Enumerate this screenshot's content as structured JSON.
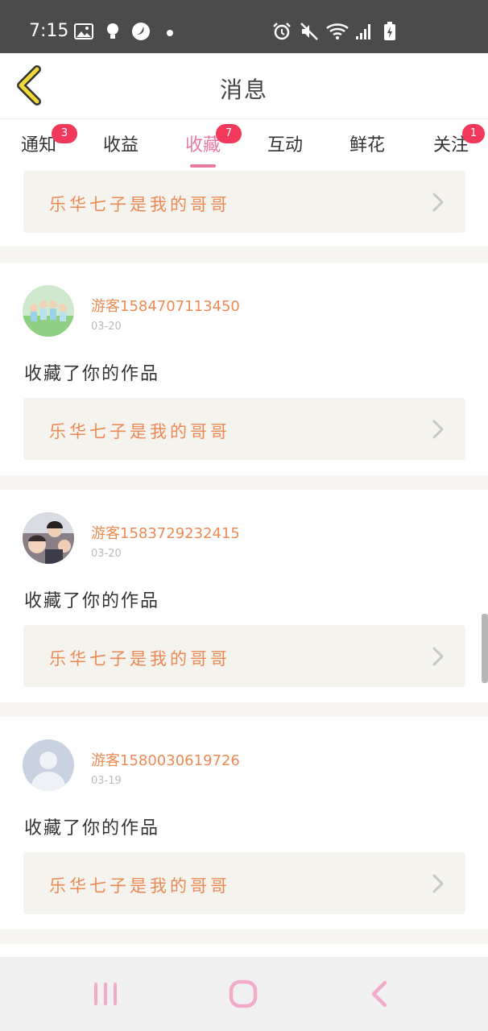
{
  "status_bar": {
    "time": "7:15",
    "icons": [
      "image-icon",
      "bulb-icon",
      "app-icon",
      "dot-icon",
      "alarm-icon",
      "mute-icon",
      "wifi-icon",
      "signal-icon",
      "battery-icon"
    ]
  },
  "header": {
    "title": "消息",
    "back_icon": "chevron-left-icon"
  },
  "tabs": [
    {
      "label": "通知",
      "badge": "3"
    },
    {
      "label": "收益",
      "badge": ""
    },
    {
      "label": "收藏",
      "badge": "7",
      "active": true
    },
    {
      "label": "互动",
      "badge": ""
    },
    {
      "label": "鲜花",
      "badge": ""
    },
    {
      "label": "关注",
      "badge": "1"
    }
  ],
  "messages": [
    {
      "work_title": "乐华七子是我的哥哥"
    },
    {
      "user": "游客15847071134​50",
      "date": "03-20",
      "text": "收藏了你的作品",
      "work_title": "乐华七子是我的哥哥"
    },
    {
      "user": "游客1583729232415",
      "date": "03-20",
      "text": "收藏了你的作品",
      "work_title": "乐华七子是我的哥哥"
    },
    {
      "user": "游客1580030619726",
      "date": "03-19",
      "text": "收藏了你的作品",
      "work_title": "乐华七子是我的哥哥"
    }
  ],
  "colors": {
    "accent": "#e87aa0",
    "orange": "#eb8a55",
    "badge": "#f2395b",
    "back_icon": "#f1d93a"
  },
  "nav_bar": {
    "icons": [
      "recent-apps-icon",
      "home-icon",
      "back-icon"
    ]
  }
}
